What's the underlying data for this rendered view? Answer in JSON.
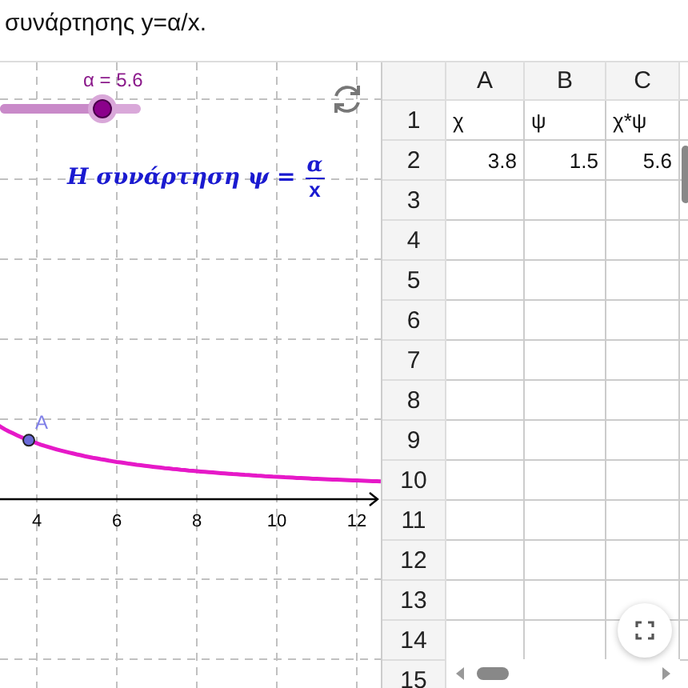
{
  "heading": "συνάρτησης y=α/x.",
  "graphics": {
    "slider": {
      "label": "α = 5.6",
      "level": 0.73
    },
    "formula": {
      "text": "Η συνάρτηση ψ =",
      "numerator": "α",
      "denominator": "x"
    },
    "point": {
      "label": "A"
    },
    "x_axis_labels": [
      "4",
      "6",
      "8",
      "10",
      "12"
    ]
  },
  "spreadsheet": {
    "columns": [
      "A",
      "B",
      "C"
    ],
    "rows": [
      {
        "number": "1",
        "cells": [
          {
            "text": "χ",
            "kind": "text"
          },
          {
            "text": "ψ",
            "kind": "text"
          },
          {
            "text": "χ*ψ",
            "kind": "text"
          }
        ]
      },
      {
        "number": "2",
        "cells": [
          {
            "text": "3.8",
            "kind": "number"
          },
          {
            "text": "1.5",
            "kind": "number"
          },
          {
            "text": "5.6",
            "kind": "number"
          }
        ]
      },
      {
        "number": "3"
      },
      {
        "number": "4"
      },
      {
        "number": "5"
      },
      {
        "number": "6"
      },
      {
        "number": "7"
      },
      {
        "number": "8"
      },
      {
        "number": "9"
      },
      {
        "number": "10"
      },
      {
        "number": "11"
      },
      {
        "number": "12"
      },
      {
        "number": "13"
      },
      {
        "number": "14"
      },
      {
        "number": "15"
      }
    ]
  }
}
